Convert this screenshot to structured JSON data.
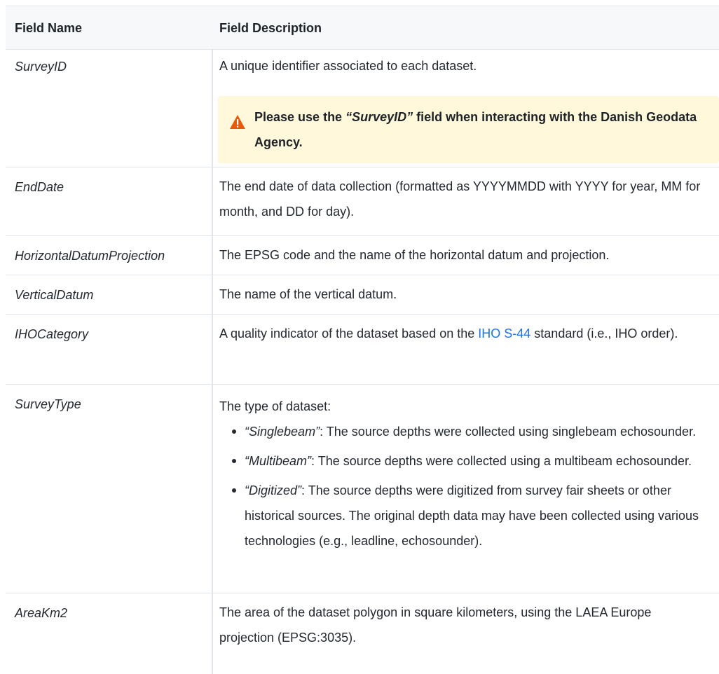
{
  "headers": {
    "field_name": "Field Name",
    "field_description": "Field Description"
  },
  "rows": [
    {
      "name": "SurveyID",
      "desc": "A unique identifier associated to each dataset.",
      "note": {
        "icon": "warning-icon",
        "pre": "Please use the ",
        "em": "“SurveyID”",
        "post": " field when interacting with the Danish Geodata Agency."
      }
    },
    {
      "name": "EndDate",
      "desc": "The end date of data collection (formatted as YYYYMMDD with YYYY for year, MM for month, and DD for day)."
    },
    {
      "name": "HorizontalDatumProjection",
      "desc": "The EPSG code and the name of the horizontal datum and projection."
    },
    {
      "name": "VerticalDatum",
      "desc": "The name of the vertical datum."
    },
    {
      "name": "IHOCategory",
      "desc_pre": "A quality indicator of the dataset based on the ",
      "link": "IHO S-44",
      "desc_post": " standard (i.e., IHO order)."
    },
    {
      "name": "SurveyType",
      "desc": "The type of dataset:",
      "items": [
        {
          "em": "“Singlebeam”",
          "text": ": The source depths were collected using singlebeam echosounder."
        },
        {
          "em": "“Multibeam”",
          "text": ": The source depths were collected using a multibeam echosounder."
        },
        {
          "em": "“Digitized”",
          "text": ": The source depths were digitized from survey fair sheets or other historical sources. The original depth data may have been collected using various technologies (e.g., leadline, echosounder)."
        }
      ]
    },
    {
      "name": "AreaKm2",
      "desc": "The area of the dataset polygon in square kilometers, using the LAEA Europe projection (EPSG:3035)."
    }
  ],
  "colors": {
    "warning_bg": "#fff8db",
    "warning_icon": "#e8590c",
    "link": "#1a73e8",
    "header_bg": "#f6f8fa"
  }
}
